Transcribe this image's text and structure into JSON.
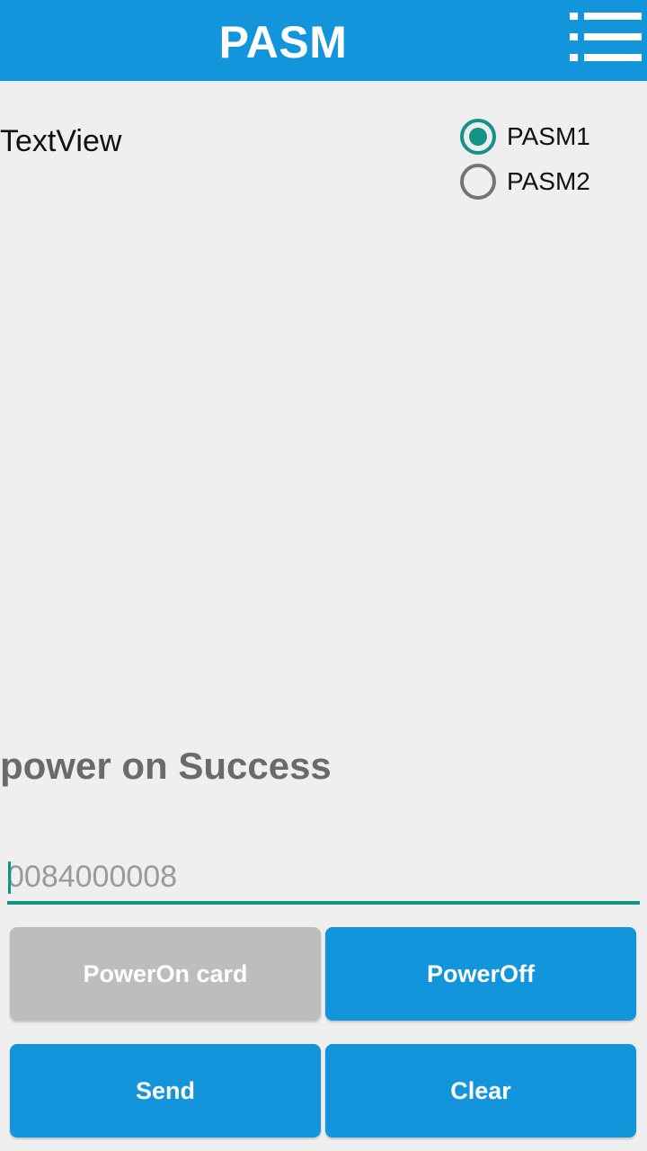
{
  "app_bar": {
    "title": "PASM",
    "menu_icon": "menu-icon",
    "color": "#1295db"
  },
  "content": {
    "textview_label": "TextView",
    "radio_options": [
      {
        "label": "PASM1",
        "checked": true
      },
      {
        "label": "PASM2",
        "checked": false
      }
    ],
    "status_text": "power on Success"
  },
  "command_input": {
    "value": "",
    "placeholder": "0084000008"
  },
  "buttons": {
    "power_on": {
      "label": "PowerOn card",
      "enabled": false
    },
    "power_off": {
      "label": "PowerOff",
      "enabled": true
    },
    "send": {
      "label": "Send",
      "enabled": true
    },
    "clear": {
      "label": "Clear",
      "enabled": true
    }
  },
  "colors": {
    "accent": "#0f9486",
    "primary": "#1295db",
    "disabled": "#bdbdbd",
    "background": "#efefef"
  }
}
